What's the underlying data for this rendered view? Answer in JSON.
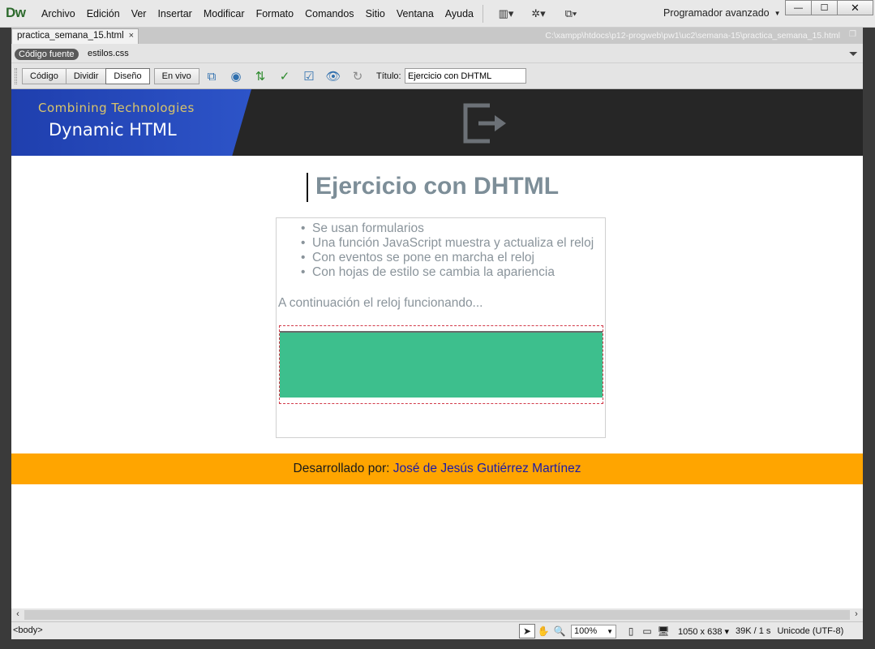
{
  "app": {
    "logo": "Dw"
  },
  "menu": {
    "items": [
      "Archivo",
      "Edición",
      "Ver",
      "Insertar",
      "Modificar",
      "Formato",
      "Comandos",
      "Sitio",
      "Ventana",
      "Ayuda"
    ],
    "icons": [
      "layout-icon",
      "gear-icon",
      "site-icon"
    ]
  },
  "workspace": {
    "label": "Programador avanzado"
  },
  "window": {
    "minimize": "—",
    "maximize": "☐",
    "close": "✕"
  },
  "doc_tab": {
    "filename": "practica_semana_15.html",
    "close": "×"
  },
  "file_path": "C:\\xampp\\htdocs\\p12-progweb\\pw1\\uc2\\semana-15\\practica_semana_15.html",
  "related_files": {
    "source": "Código fuente",
    "css": "estilos.css"
  },
  "toolbar": {
    "code": "Código",
    "split": "Dividir",
    "design": "Diseño",
    "live": "En vivo",
    "title_label": "Título:",
    "title_value": "Ejercicio con DHTML"
  },
  "page": {
    "banner_subtitle": "Combining Technologies",
    "banner_title": "Dynamic HTML",
    "heading": "Ejercicio con DHTML",
    "bullets": [
      "Se usan formularios",
      "Una función JavaScript muestra y actualiza el reloj",
      "Con eventos se pone en marcha el reloj",
      "Con hojas de estilo se cambia la apariencia"
    ],
    "continuation": "A continuación el reloj funcionando...",
    "footer_prefix": "Desarrollado por: ",
    "footer_author": "José de Jesús Gutiérrez Martínez"
  },
  "colors": {
    "banner_blue": "#2d54c8",
    "banner_dark": "#262626",
    "clock_green": "#3dbf8d",
    "footer_orange": "#ffa500",
    "heading_grey": "#7d8e98"
  },
  "statusbar": {
    "tag": "<body>",
    "zoom": "100%",
    "dimensions": "1050 x 638",
    "size": "39K / 1 s",
    "encoding": "Unicode (UTF-8)"
  }
}
